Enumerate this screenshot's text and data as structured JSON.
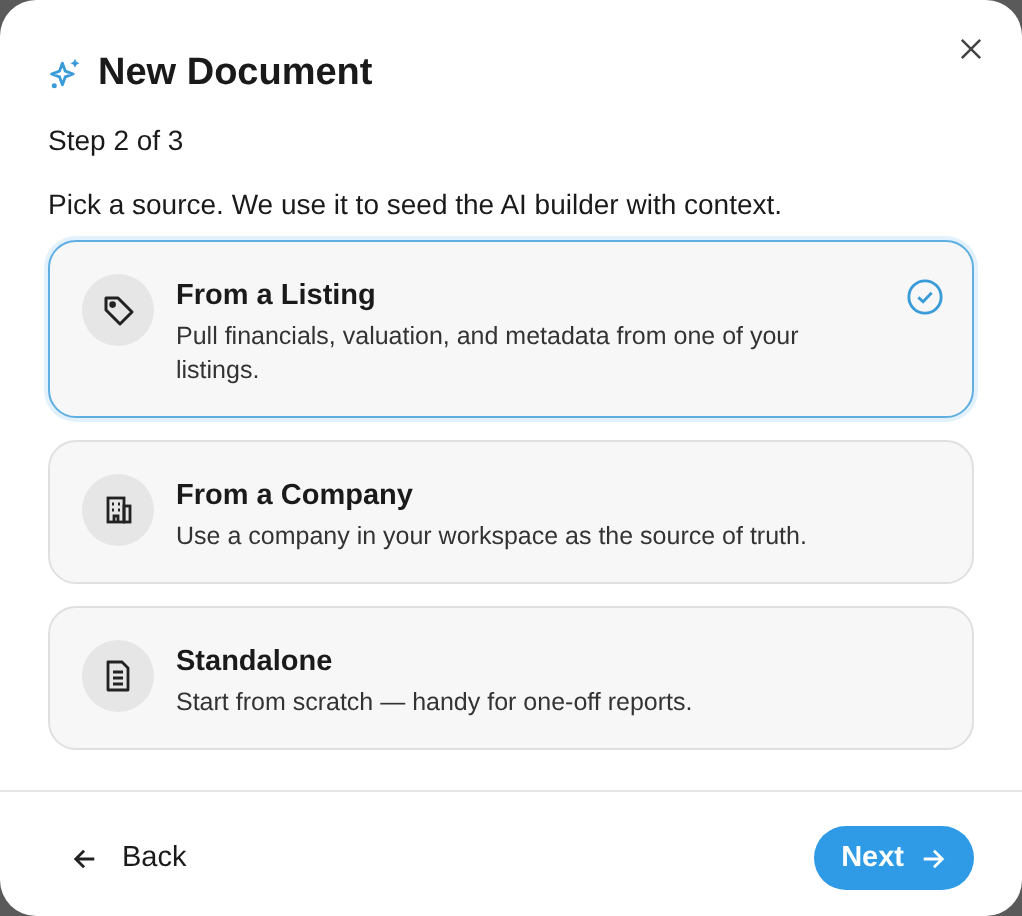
{
  "dialog": {
    "title": "New Document",
    "step": "Step 2 of 3",
    "prompt": "Pick a source. We use it to seed the AI builder with context."
  },
  "options": [
    {
      "kind": "tag",
      "title": "From a Listing",
      "description": "Pull financials, valuation, and metadata from one of your listings.",
      "selected": true
    },
    {
      "kind": "building",
      "title": "From a Company",
      "description": "Use a company in your workspace as the source of truth.",
      "selected": false
    },
    {
      "kind": "document",
      "title": "Standalone",
      "description": "Start from scratch — handy for one-off reports.",
      "selected": false
    }
  ],
  "footer": {
    "back": "Back",
    "next": "Next"
  }
}
